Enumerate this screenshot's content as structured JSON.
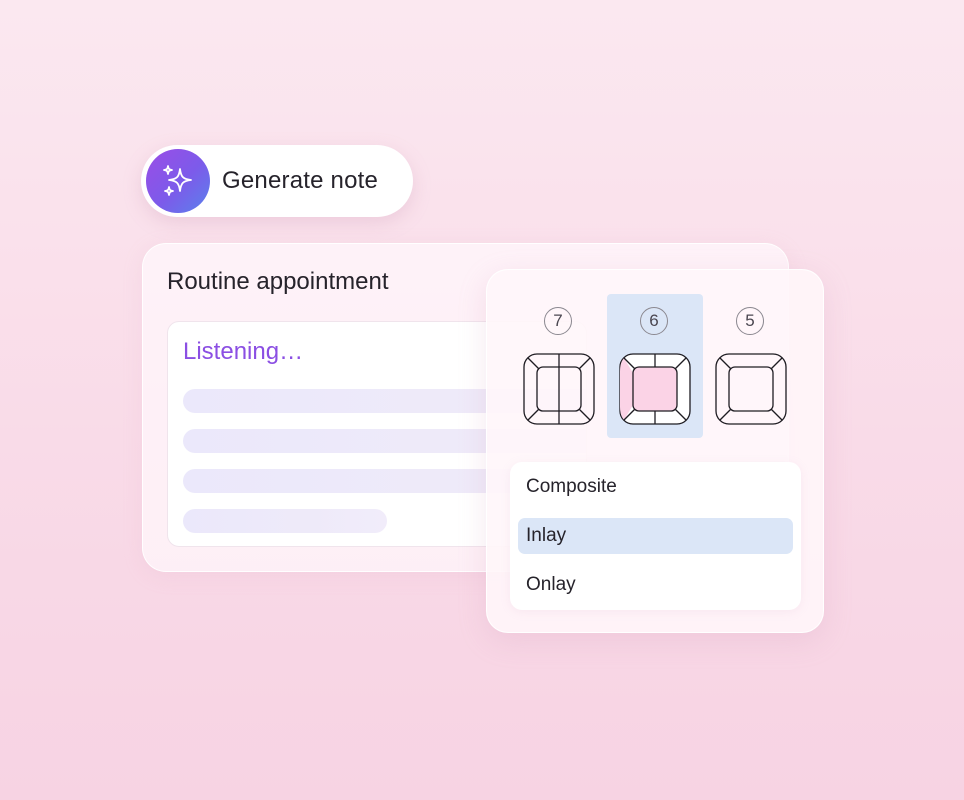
{
  "generate": {
    "label": "Generate note",
    "icon": "sparkles-icon"
  },
  "appointment": {
    "title": "Routine appointment",
    "status": "Listening…"
  },
  "tooth_chart": {
    "teeth": [
      {
        "number": "7",
        "selected": false,
        "filled": false
      },
      {
        "number": "6",
        "selected": true,
        "filled": true
      },
      {
        "number": "5",
        "selected": false,
        "filled": false
      }
    ]
  },
  "restoration_options": [
    {
      "label": "Composite",
      "active": false
    },
    {
      "label": "Inlay",
      "active": true
    },
    {
      "label": "Onlay",
      "active": false
    }
  ],
  "colors": {
    "accent_purple": "#8b4fe3",
    "selection_blue": "#dbe6f7",
    "tooth_fill_pink": "#fbd3e6"
  }
}
